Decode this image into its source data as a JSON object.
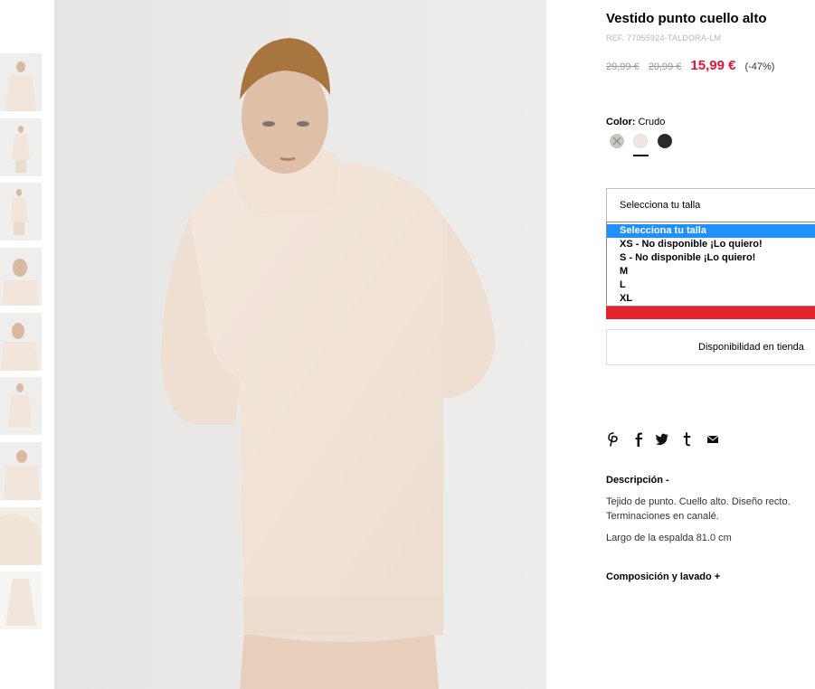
{
  "product": {
    "title": "Vestido punto cuello alto",
    "ref": "REF. 77055924-TALDORA-LM",
    "price_original": "29,99 €",
    "price_previous": "20,99 €",
    "price_current": "15,99 €",
    "discount": "(-47%)"
  },
  "color": {
    "label": "Color:",
    "selected": "Crudo",
    "swatches": [
      {
        "name": "gris-claro",
        "hex": "#c9c5c0"
      },
      {
        "name": "crudo",
        "hex": "#efe8e1"
      },
      {
        "name": "negro",
        "hex": "#2a2a2a"
      }
    ]
  },
  "size": {
    "placeholder": "Selecciona tu talla",
    "options": [
      "Selecciona tu talla",
      "XS - No disponible ¡Lo quiero!",
      "S - No disponible ¡Lo quiero!",
      "M",
      "L",
      "XL"
    ]
  },
  "stores_button": "Disponibilidad en tienda",
  "share": {
    "icons": [
      "pinterest-icon",
      "facebook-icon",
      "twitter-icon",
      "tumblr-icon",
      "email-icon"
    ]
  },
  "description": {
    "heading": "Descripción -",
    "line1": "Tejido de punto. Cuello alto. Diseño recto.",
    "line2": "Terminaciones en canalé.",
    "line3": "Largo de la espalda 81.0 cm"
  },
  "composition": {
    "heading": "Composición y lavado +"
  },
  "colors": {
    "sale_red": "#e5133a",
    "highlight_blue": "#1e90ff",
    "bar_red": "#e3242b"
  }
}
